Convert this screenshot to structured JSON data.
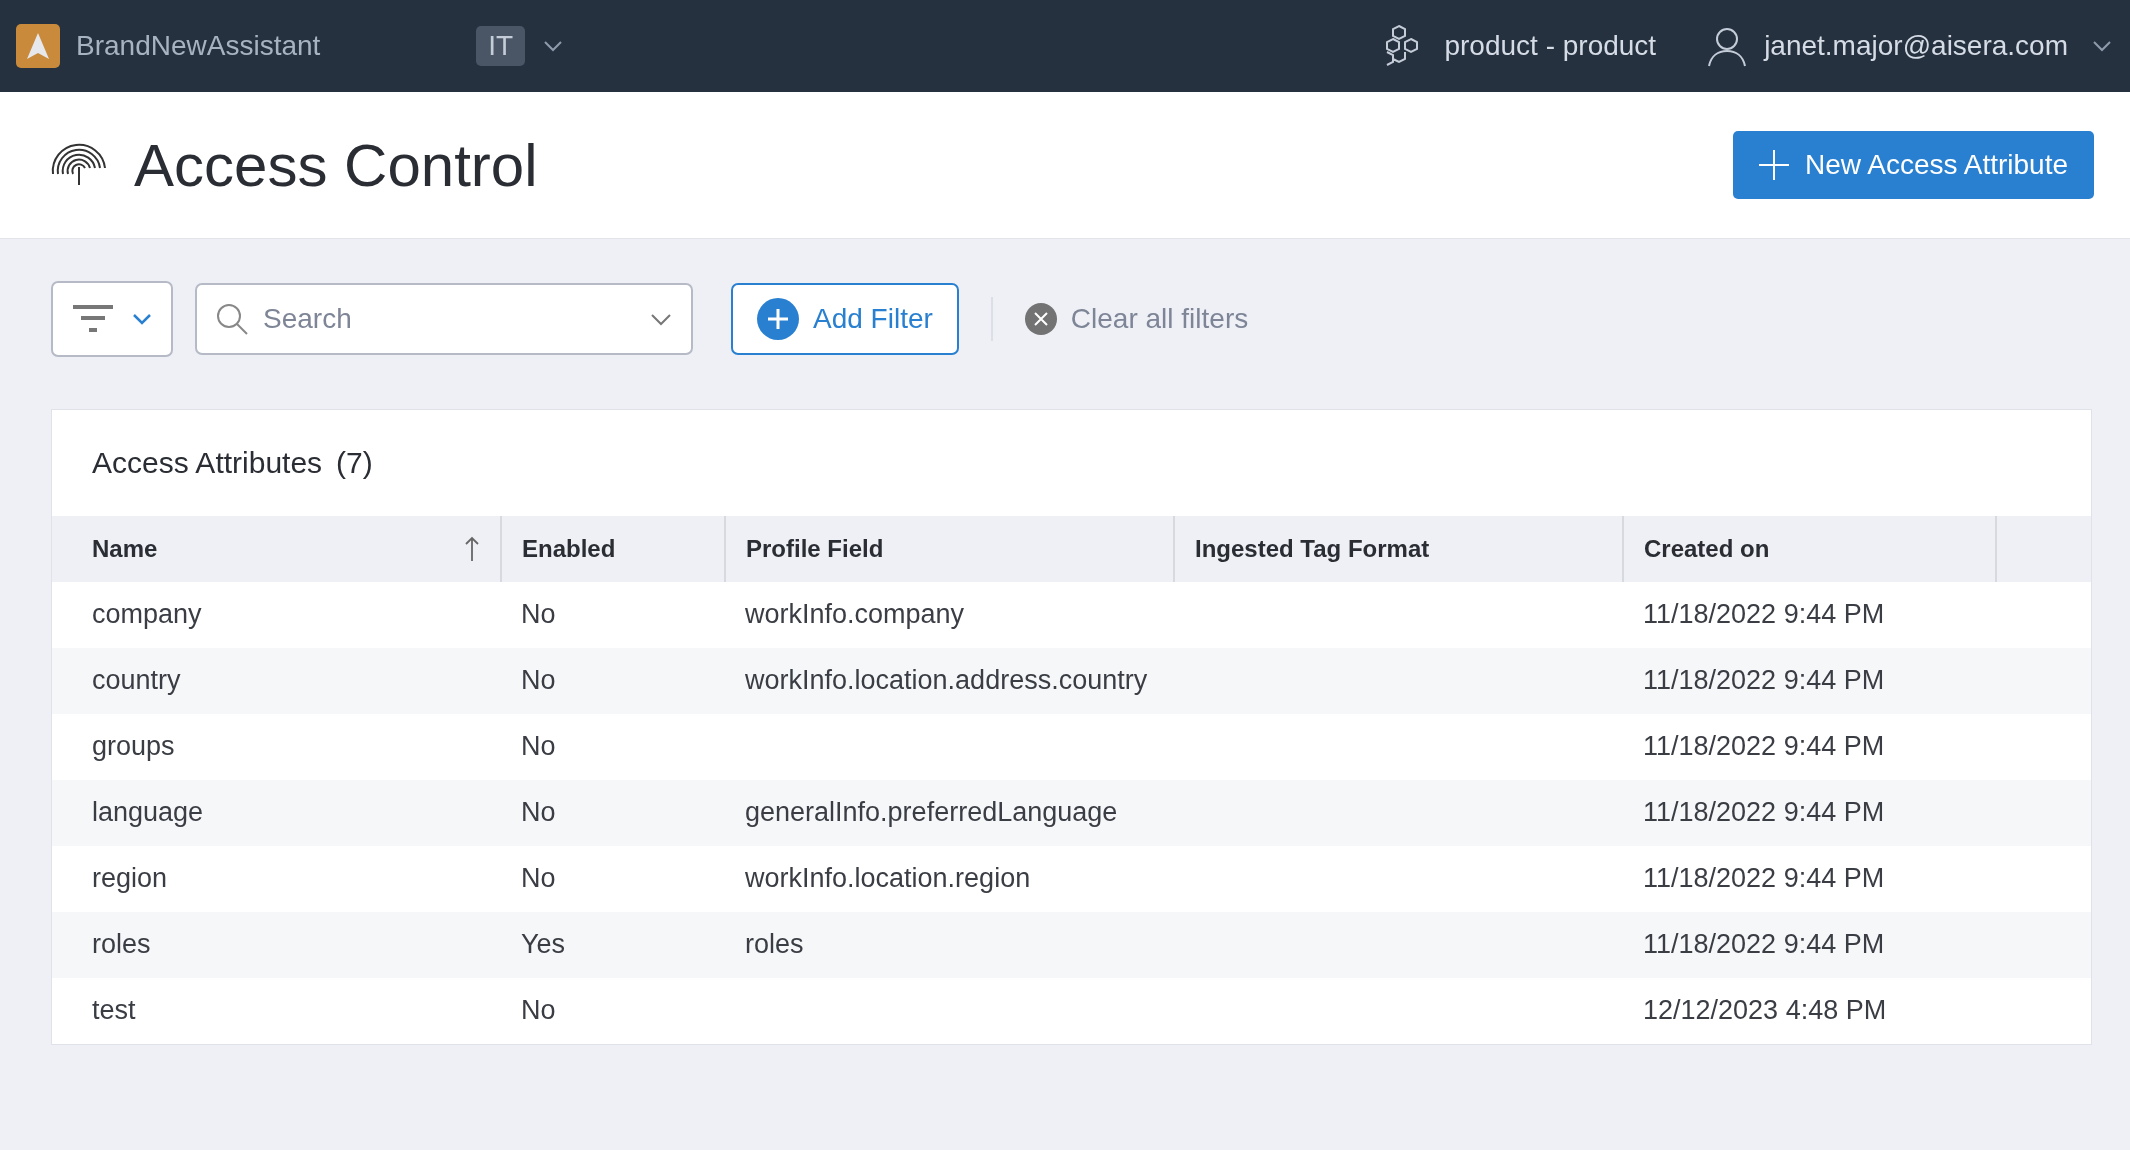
{
  "top_bar": {
    "app_name": "BrandNewAssistant",
    "workspace_badge": "IT",
    "product": "product - product",
    "user_email": "janet.major@aisera.com"
  },
  "header": {
    "title": "Access Control",
    "new_button": "New Access Attribute"
  },
  "filters": {
    "search_placeholder": "Search",
    "add_filter": "Add Filter",
    "clear_all": "Clear all filters"
  },
  "table": {
    "title": "Access Attributes",
    "count": "(7)",
    "columns": [
      {
        "label": "Name",
        "sorted": true
      },
      {
        "label": "Enabled",
        "sorted": false
      },
      {
        "label": "Profile Field",
        "sorted": false
      },
      {
        "label": "Ingested Tag Format",
        "sorted": false
      },
      {
        "label": "Created on",
        "sorted": false
      }
    ],
    "rows": [
      [
        "company",
        "No",
        "workInfo.company",
        "",
        "11/18/2022 9:44 PM"
      ],
      [
        "country",
        "No",
        "workInfo.location.address.country",
        "",
        "11/18/2022 9:44 PM"
      ],
      [
        "groups",
        "No",
        "",
        "",
        "11/18/2022 9:44 PM"
      ],
      [
        "language",
        "No",
        "generalInfo.preferredLanguage",
        "",
        "11/18/2022 9:44 PM"
      ],
      [
        "region",
        "No",
        "workInfo.location.region",
        "",
        "11/18/2022 9:44 PM"
      ],
      [
        "roles",
        "Yes",
        "roles",
        "",
        "11/18/2022 9:44 PM"
      ],
      [
        "test",
        "No",
        "",
        "",
        "12/12/2023 4:48 PM"
      ]
    ]
  }
}
